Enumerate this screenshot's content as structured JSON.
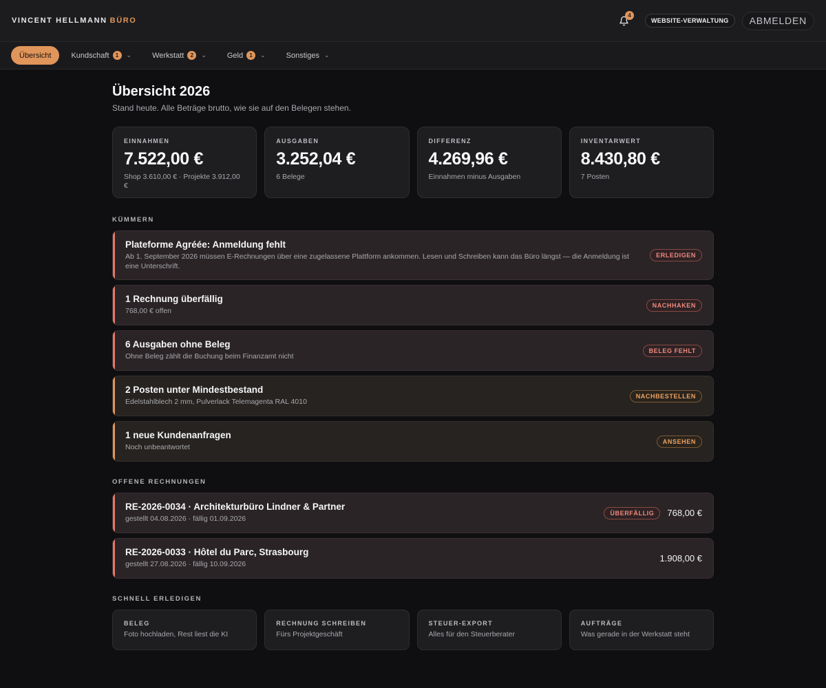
{
  "header": {
    "brand": "VINCENT HELLMANN",
    "brand_accent": "BÜRO",
    "notifications_count": "4",
    "website_button": "WEBSITE-VERWALTUNG",
    "logout_button": "ABMELDEN"
  },
  "nav": {
    "items": [
      {
        "label": "Übersicht",
        "badge": ""
      },
      {
        "label": "Kundschaft",
        "badge": "1"
      },
      {
        "label": "Werkstatt",
        "badge": "2"
      },
      {
        "label": "Geld",
        "badge": "1"
      },
      {
        "label": "Sonstiges",
        "badge": ""
      }
    ]
  },
  "page": {
    "title": "Übersicht 2026",
    "subtitle": "Stand heute. Alle Beträge brutto, wie sie auf den Belegen stehen."
  },
  "stats": [
    {
      "label": "EINNAHMEN",
      "value": "7.522,00 €",
      "note": "Shop 3.610,00 € · Projekte 3.912,00 €"
    },
    {
      "label": "AUSGABEN",
      "value": "3.252,04 €",
      "note": "6 Belege"
    },
    {
      "label": "DIFFERENZ",
      "value": "4.269,96 €",
      "note": "Einnahmen minus Ausgaben"
    },
    {
      "label": "INVENTARWERT",
      "value": "8.430,80 €",
      "note": "7 Posten"
    }
  ],
  "kuemmern": {
    "label": "KÜMMERN",
    "items": [
      {
        "title": "Plateforme Agréée: Anmeldung fehlt",
        "text": "Ab 1. September 2026 müssen E-Rechnungen über eine zugelassene Plattform ankommen. Lesen und Schreiben kann das Büro längst — die Anmeldung ist eine Unterschrift.",
        "action": "ERLEDIGEN"
      },
      {
        "title": "1 Rechnung überfällig",
        "text": "768,00 € offen",
        "action": "NACHHAKEN"
      },
      {
        "title": "6 Ausgaben ohne Beleg",
        "text": "Ohne Beleg zählt die Buchung beim Finanzamt nicht",
        "action": "BELEG FEHLT"
      },
      {
        "title": "2 Posten unter Mindestbestand",
        "text": "Edelstahlblech 2 mm, Pulverlack Telemagenta RAL 4010",
        "action": "NACHBESTELLEN"
      },
      {
        "title": "1 neue Kundenanfragen",
        "text": "Noch unbeantwortet",
        "action": "ANSEHEN"
      }
    ]
  },
  "invoices": {
    "label": "OFFENE RECHNUNGEN",
    "items": [
      {
        "title": "RE-2026-0034 · Architekturbüro Lindner & Partner",
        "meta": "gestellt 04.08.2026 · fällig 01.09.2026",
        "status": "ÜBERFÄLLIG",
        "amount": "768,00 €"
      },
      {
        "title": "RE-2026-0033 · Hôtel du Parc, Strasbourg",
        "meta": "gestellt 27.08.2026 · fällig 10.09.2026",
        "status": "",
        "amount": "1.908,00 €"
      }
    ]
  },
  "quick": {
    "label": "SCHNELL ERLEDIGEN",
    "items": [
      {
        "title": "BELEG",
        "text": "Foto hochladen, Rest liest die KI"
      },
      {
        "title": "RECHNUNG SCHREIBEN",
        "text": "Fürs Projektgeschäft"
      },
      {
        "title": "STEUER-EXPORT",
        "text": "Alles für den Steuerberater"
      },
      {
        "title": "AUFTRÄGE",
        "text": "Was gerade in der Werkstatt steht"
      }
    ]
  },
  "colors": {
    "accent": "#e0955a",
    "danger": "#e5776b",
    "background": "#0f0f11"
  }
}
